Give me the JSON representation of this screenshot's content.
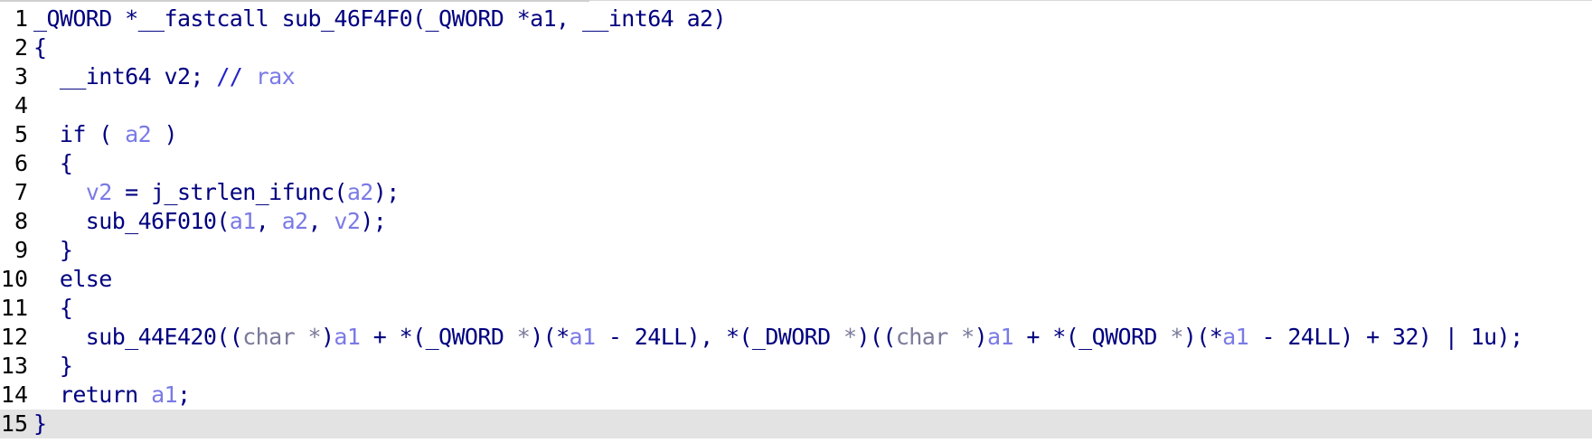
{
  "editor": {
    "lines": [
      {
        "number": "1",
        "segments": [
          {
            "text": "_QWORD *__fastcall sub_46F4F0(_QWORD *a1, __int64 a2)",
            "kind": "txt"
          }
        ]
      },
      {
        "number": "2",
        "segments": [
          {
            "text": "{",
            "kind": "txt"
          }
        ]
      },
      {
        "number": "3",
        "segments": [
          {
            "text": "  __int64 v2; ",
            "kind": "txt"
          },
          {
            "text": "// ",
            "kind": "cmt"
          },
          {
            "text": "rax",
            "kind": "var"
          }
        ]
      },
      {
        "number": "4",
        "segments": [
          {
            "text": "",
            "kind": "txt"
          }
        ]
      },
      {
        "number": "5",
        "segments": [
          {
            "text": "  if ( ",
            "kind": "txt"
          },
          {
            "text": "a2",
            "kind": "var"
          },
          {
            "text": " )",
            "kind": "txt"
          }
        ]
      },
      {
        "number": "6",
        "segments": [
          {
            "text": "  {",
            "kind": "txt"
          }
        ]
      },
      {
        "number": "7",
        "segments": [
          {
            "text": "    ",
            "kind": "txt"
          },
          {
            "text": "v2",
            "kind": "var"
          },
          {
            "text": " = j_strlen_ifunc(",
            "kind": "txt"
          },
          {
            "text": "a2",
            "kind": "var"
          },
          {
            "text": ");",
            "kind": "txt"
          }
        ]
      },
      {
        "number": "8",
        "segments": [
          {
            "text": "    sub_46F010(",
            "kind": "txt"
          },
          {
            "text": "a1",
            "kind": "var"
          },
          {
            "text": ", ",
            "kind": "txt"
          },
          {
            "text": "a2",
            "kind": "var"
          },
          {
            "text": ", ",
            "kind": "txt"
          },
          {
            "text": "v2",
            "kind": "var"
          },
          {
            "text": ");",
            "kind": "txt"
          }
        ]
      },
      {
        "number": "9",
        "segments": [
          {
            "text": "  }",
            "kind": "txt"
          }
        ]
      },
      {
        "number": "10",
        "segments": [
          {
            "text": "  else",
            "kind": "txt"
          }
        ]
      },
      {
        "number": "11",
        "segments": [
          {
            "text": "  {",
            "kind": "txt"
          }
        ]
      },
      {
        "number": "12",
        "segments": [
          {
            "text": "    sub_44E420((",
            "kind": "txt"
          },
          {
            "text": "char *",
            "kind": "cast"
          },
          {
            "text": ")",
            "kind": "txt"
          },
          {
            "text": "a1",
            "kind": "var"
          },
          {
            "text": " + *(_QWORD ",
            "kind": "txt"
          },
          {
            "text": "*",
            "kind": "cast"
          },
          {
            "text": ")(*",
            "kind": "txt"
          },
          {
            "text": "a1",
            "kind": "var"
          },
          {
            "text": " - 24LL), *(_DWORD ",
            "kind": "txt"
          },
          {
            "text": "*",
            "kind": "cast"
          },
          {
            "text": ")((",
            "kind": "txt"
          },
          {
            "text": "char *",
            "kind": "cast"
          },
          {
            "text": ")",
            "kind": "txt"
          },
          {
            "text": "a1",
            "kind": "var"
          },
          {
            "text": " + *(_QWORD ",
            "kind": "txt"
          },
          {
            "text": "*",
            "kind": "cast"
          },
          {
            "text": ")(*",
            "kind": "txt"
          },
          {
            "text": "a1",
            "kind": "var"
          },
          {
            "text": " - 24LL) + 32) | 1u);",
            "kind": "txt"
          }
        ]
      },
      {
        "number": "13",
        "segments": [
          {
            "text": "  }",
            "kind": "txt"
          }
        ]
      },
      {
        "number": "14",
        "segments": [
          {
            "text": "  return ",
            "kind": "txt"
          },
          {
            "text": "a1",
            "kind": "var"
          },
          {
            "text": ";",
            "kind": "txt"
          }
        ]
      },
      {
        "number": "15",
        "current": true,
        "segments": [
          {
            "text": "}",
            "kind": "txt"
          }
        ]
      }
    ]
  },
  "colors": {
    "code_text": "#000080",
    "variable": "#7a7ae6",
    "comment": "#2222cc",
    "current_line_highlight": "#e3e3e3",
    "line_number": "#000000"
  }
}
